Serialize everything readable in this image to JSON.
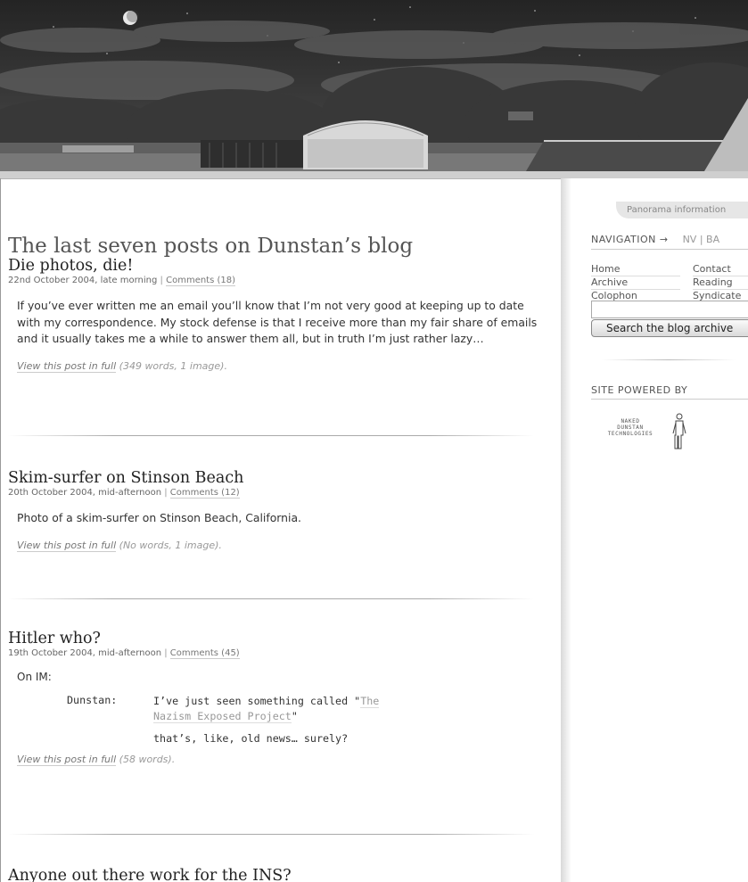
{
  "header": {
    "panorama_label": "Panorama information"
  },
  "main": {
    "page_title": "The last seven posts on Dunstan’s blog",
    "posts": [
      {
        "title": "Die photos, die!",
        "date": "22nd October 2004, late morning",
        "comments": "Comments (18)",
        "excerpt": "If you’ve ever written me an email you’ll know that I’m not very good at keeping up to date with my correspondence. My stock defense is that I receive more than my fair share of emails and it usually takes me a while to answer them all, but in truth I’m just rather lazy…",
        "view_full": "View this post in full",
        "view_full_info": "(349 words, 1 image)."
      },
      {
        "title": "Skim-surfer on Stinson Beach",
        "date": "20th October 2004, mid-afternoon",
        "comments": "Comments (12)",
        "excerpt": "Photo of a skim-surfer on Stinson Beach, California.",
        "view_full": "View this post in full",
        "view_full_info": "(No words, 1 image)."
      },
      {
        "title": "Hitler who?",
        "date": "19th October 2004, mid-afternoon",
        "comments": "Comments (45)",
        "intro": "On IM:",
        "im": {
          "speaker": "Dunstan:",
          "line1_pre": "I’ve just seen something called \"",
          "line1_link": "The Nazism Exposed Project",
          "line1_post": "\"",
          "line2": "that’s, like, old news… surely?"
        },
        "view_full": "View this post in full",
        "view_full_info": "(58 words)."
      },
      {
        "title": "Anyone out there work for the INS?"
      }
    ],
    "meta_separator": "|"
  },
  "sidebar": {
    "nav_heading": "NAVIGATION →",
    "nav_switch": "NV | BA",
    "nav_links": [
      "Home",
      "Contact",
      "Archive",
      "Reading",
      "Colophon",
      "Syndicate"
    ],
    "search_placeholder": "",
    "search_button": "Search the blog archive",
    "powered_heading": "SITE POWERED BY",
    "logo_lines": [
      "NAKED",
      "DUNSTAN",
      "TECHNOLOGIES"
    ]
  }
}
